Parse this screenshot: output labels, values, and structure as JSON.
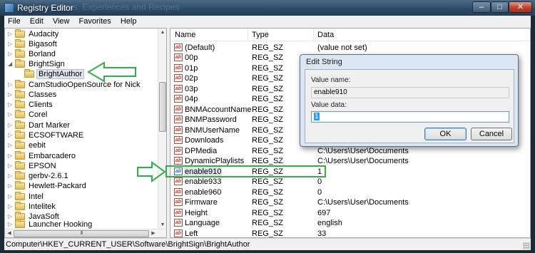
{
  "window": {
    "title": "Registry Editor",
    "background_text": "y Ideas, Experiences and Recipes",
    "min_label": "–",
    "max_label": "□",
    "close_label": "✕"
  },
  "menu": [
    "File",
    "Edit",
    "View",
    "Favorites",
    "Help"
  ],
  "tree": {
    "items": [
      {
        "label": "Audacity",
        "expander": "▷"
      },
      {
        "label": "Bigasoft",
        "expander": "▷"
      },
      {
        "label": "Borland",
        "expander": "▷"
      },
      {
        "label": "BrightSign",
        "expander": "◢"
      },
      {
        "label": "BrightAuthor",
        "expander": ""
      },
      {
        "label": "CamStudioOpenSource for Nick",
        "expander": "▷"
      },
      {
        "label": "Classes",
        "expander": "▷"
      },
      {
        "label": "Clients",
        "expander": "▷"
      },
      {
        "label": "Corel",
        "expander": "▷"
      },
      {
        "label": "Dart Marker",
        "expander": "▷"
      },
      {
        "label": "ECSOFTWARE",
        "expander": "▷"
      },
      {
        "label": "eebit",
        "expander": "▷"
      },
      {
        "label": "Embarcadero",
        "expander": "▷"
      },
      {
        "label": "EPSON",
        "expander": "▷"
      },
      {
        "label": "gerbv-2.6.1",
        "expander": "▷"
      },
      {
        "label": "Hewlett-Packard",
        "expander": "▷"
      },
      {
        "label": "Intel",
        "expander": "▷"
      },
      {
        "label": "Intelitek",
        "expander": "▷"
      },
      {
        "label": "JavaSoft",
        "expander": "▷"
      },
      {
        "label": "Launcher Hooking",
        "expander": "▷"
      }
    ],
    "scroll_up": "▲",
    "scroll_down": "▼",
    "scroll_left": "◀",
    "scroll_right": "▶",
    "hthumb_grip": "III"
  },
  "list": {
    "headers": {
      "name": "Name",
      "type": "Type",
      "data": "Data"
    },
    "icon_text": "ab",
    "rows": [
      {
        "name": "(Default)",
        "type": "REG_SZ",
        "data": "(value not set)"
      },
      {
        "name": "00p",
        "type": "REG_SZ",
        "data": ""
      },
      {
        "name": "01p",
        "type": "REG_SZ",
        "data": ""
      },
      {
        "name": "02p",
        "type": "REG_SZ",
        "data": ""
      },
      {
        "name": "03p",
        "type": "REG_SZ",
        "data": ""
      },
      {
        "name": "04p",
        "type": "REG_SZ",
        "data": ""
      },
      {
        "name": "BNMAccountName",
        "type": "REG_SZ",
        "data": ""
      },
      {
        "name": "BNMPassword",
        "type": "REG_SZ",
        "data": ""
      },
      {
        "name": "BNMUserName",
        "type": "REG_SZ",
        "data": ""
      },
      {
        "name": "Downloads",
        "type": "REG_SZ",
        "data": ""
      },
      {
        "name": "DPMedia",
        "type": "REG_SZ",
        "data": "C:\\Users\\User\\Documents"
      },
      {
        "name": "DynamicPlaylists",
        "type": "REG_SZ",
        "data": "C:\\Users\\User\\Documents"
      },
      {
        "name": "enable910",
        "type": "REG_SZ",
        "data": "1"
      },
      {
        "name": "enable933",
        "type": "REG_SZ",
        "data": "0"
      },
      {
        "name": "enable960",
        "type": "REG_SZ",
        "data": "0"
      },
      {
        "name": "Firmware",
        "type": "REG_SZ",
        "data": "C:\\Users\\User\\Documents"
      },
      {
        "name": "Height",
        "type": "REG_SZ",
        "data": "697"
      },
      {
        "name": "Language",
        "type": "REG_SZ",
        "data": "english"
      },
      {
        "name": "Left",
        "type": "REG_SZ",
        "data": "33"
      }
    ]
  },
  "status": {
    "path": "Computer\\HKEY_CURRENT_USER\\Software\\BrightSign\\BrightAuthor"
  },
  "dialog": {
    "title": "Edit String",
    "value_name_label": "Value name:",
    "value_name": "enable910",
    "value_data_label": "Value data:",
    "value_data": "1",
    "ok_label": "OK",
    "cancel_label": "Cancel"
  },
  "colors": {
    "annotation": "#2fb044",
    "selection": "#3399ff"
  }
}
